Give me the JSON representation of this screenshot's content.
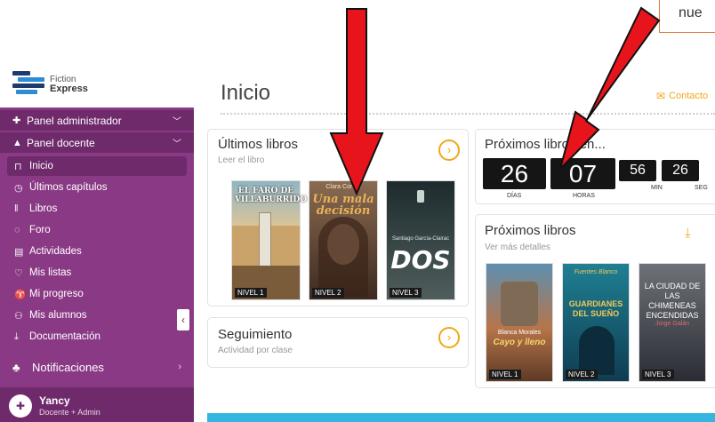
{
  "logo": {
    "line1": "Fiction",
    "line2": "Express"
  },
  "sidebar": {
    "sections": [
      {
        "label": "Panel administrador"
      },
      {
        "label": "Panel docente"
      }
    ],
    "items": [
      {
        "label": "Inicio",
        "icon": "board-icon"
      },
      {
        "label": "Últimos capítulos",
        "icon": "clock-icon"
      },
      {
        "label": "Libros",
        "icon": "books-icon"
      },
      {
        "label": "Foro",
        "icon": "chat-icon"
      },
      {
        "label": "Actividades",
        "icon": "document-icon"
      },
      {
        "label": "Mis listas",
        "icon": "heart-icon"
      },
      {
        "label": "Mi progreso",
        "icon": "trophy-icon"
      },
      {
        "label": "Mis alumnos",
        "icon": "students-icon"
      },
      {
        "label": "Documentación",
        "icon": "download-icon"
      }
    ],
    "notifications": "Notificaciones",
    "user": {
      "name": "Yancy",
      "role": "Docente + Admin"
    }
  },
  "header": {
    "title": "Inicio",
    "contact": "Contacto"
  },
  "callout": {
    "text": "nue"
  },
  "latest_books": {
    "title": "Últimos libros",
    "subtitle": "Leer el libro",
    "books": [
      {
        "title": "EL FARO DE VILLABURRIDO",
        "level": "NIVEL 1"
      },
      {
        "author": "Clara Cortés",
        "title": "Una mala decisión",
        "level": "NIVEL 2"
      },
      {
        "author": "Santiago García-Clairac",
        "title": "DOS",
        "level": "NIVEL 3"
      }
    ]
  },
  "countdown": {
    "title": "Próximos libros en...",
    "units": [
      {
        "value": "26",
        "label": "DÍAS"
      },
      {
        "value": "07",
        "label": "HORAS"
      },
      {
        "value": "56",
        "label": "MIN"
      },
      {
        "value": "26",
        "label": "SEG"
      }
    ]
  },
  "next_books": {
    "title": "Próximos libros",
    "subtitle": "Ver más detalles",
    "books": [
      {
        "author": "Blanca Morales",
        "title": "Cayo y lleno",
        "level": "NIVEL 1"
      },
      {
        "author": "Fuentes Blanco",
        "title": "GUARDIANES DEL SUEÑO",
        "level": "NIVEL 2"
      },
      {
        "title": "LA CIUDAD DE LAS CHIMENEAS ENCENDIDAS",
        "author": "Jorge Galán",
        "level": "NIVEL 3"
      }
    ]
  },
  "tracking": {
    "title": "Seguimiento",
    "subtitle": "Actividad por clase"
  },
  "colors": {
    "sidebar": "#8a3a85",
    "sidebar_dark": "#6f2a6b",
    "accent": "#f0a81a",
    "arrow": "#e8141b",
    "bottom_bar": "#34b6e0"
  }
}
